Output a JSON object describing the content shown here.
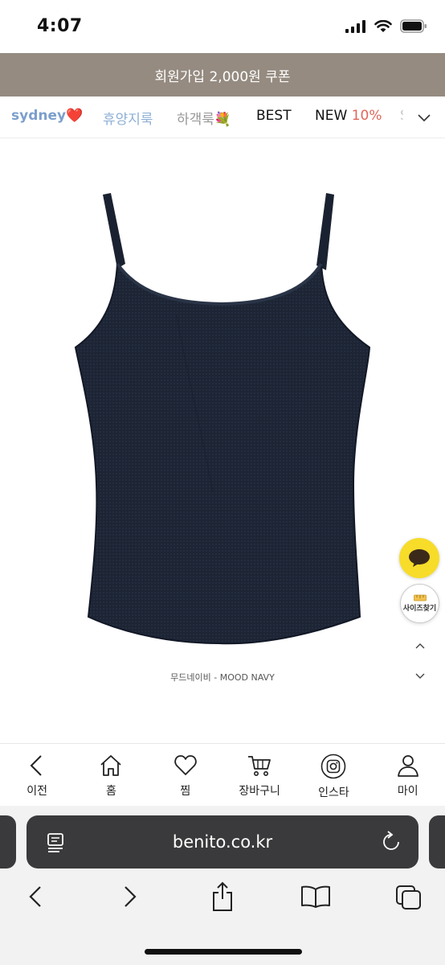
{
  "status_bar": {
    "time": "4:07"
  },
  "promo": {
    "text": "회원가입 2,000원 쿠폰"
  },
  "category_nav": {
    "items": [
      {
        "label": "sydney",
        "emoji": "❤️"
      },
      {
        "label": "휴양지룩"
      },
      {
        "label": "하객룩",
        "emoji": "💐"
      },
      {
        "label": "BEST"
      },
      {
        "label": "NEW",
        "badge": "10%"
      },
      {
        "label": "S"
      }
    ]
  },
  "product": {
    "caption": "무드네이비 - MOOD NAVY",
    "color": "#1c2433"
  },
  "floating": {
    "size_finder_label": "사이즈찾기"
  },
  "bottom_nav": {
    "tabs": [
      {
        "label": "이전",
        "icon": "back-arrow-icon"
      },
      {
        "label": "홈",
        "icon": "home-icon"
      },
      {
        "label": "찜",
        "icon": "heart-icon"
      },
      {
        "label": "장바구니",
        "icon": "cart-icon"
      },
      {
        "label": "인스타",
        "icon": "instagram-icon"
      },
      {
        "label": "마이",
        "icon": "person-icon"
      }
    ]
  },
  "browser": {
    "url": "benito.co.kr"
  },
  "colors": {
    "promo_bg": "#958b80",
    "sydney": "#7c9fcc",
    "new_badge": "#e0665a",
    "kakao": "#f7dc2a"
  }
}
